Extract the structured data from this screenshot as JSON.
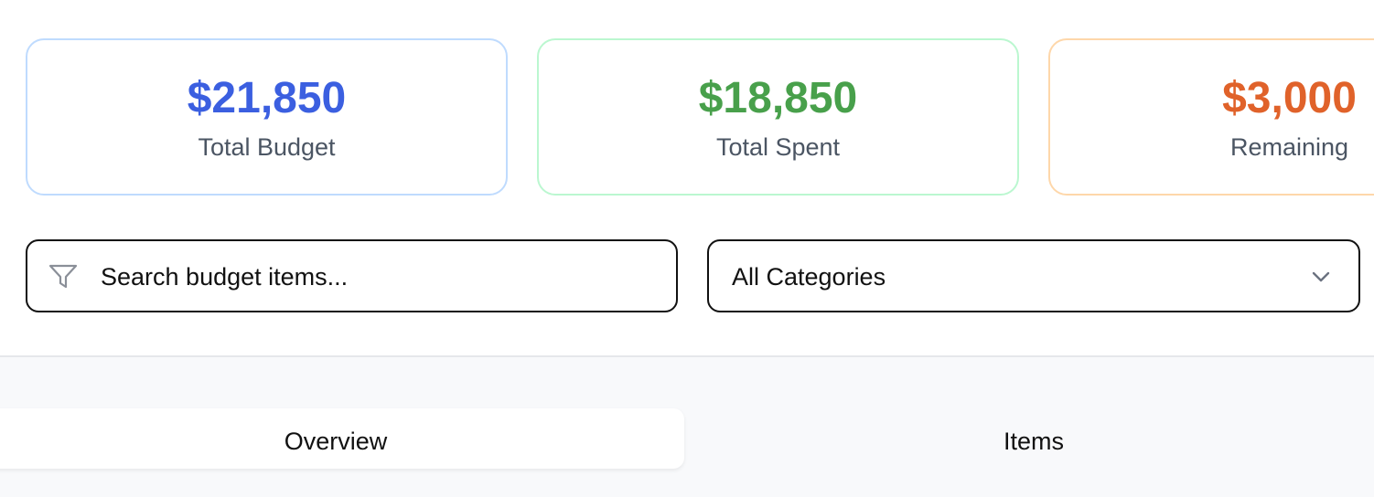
{
  "summary": {
    "cards": [
      {
        "value": "$21,850",
        "label": "Total Budget",
        "color": "#3b5fe0"
      },
      {
        "value": "$18,850",
        "label": "Total Spent",
        "color": "#48a04b"
      },
      {
        "value": "$3,000",
        "label": "Remaining",
        "color": "#e0622a"
      }
    ]
  },
  "filters": {
    "search_placeholder": "Search budget items...",
    "category_selected": "All Categories",
    "search_icon": "filter-icon",
    "select_icon": "chevron-down-icon"
  },
  "tabs": [
    {
      "label": "Overview",
      "active": true
    },
    {
      "label": "Items",
      "active": false
    }
  ]
}
